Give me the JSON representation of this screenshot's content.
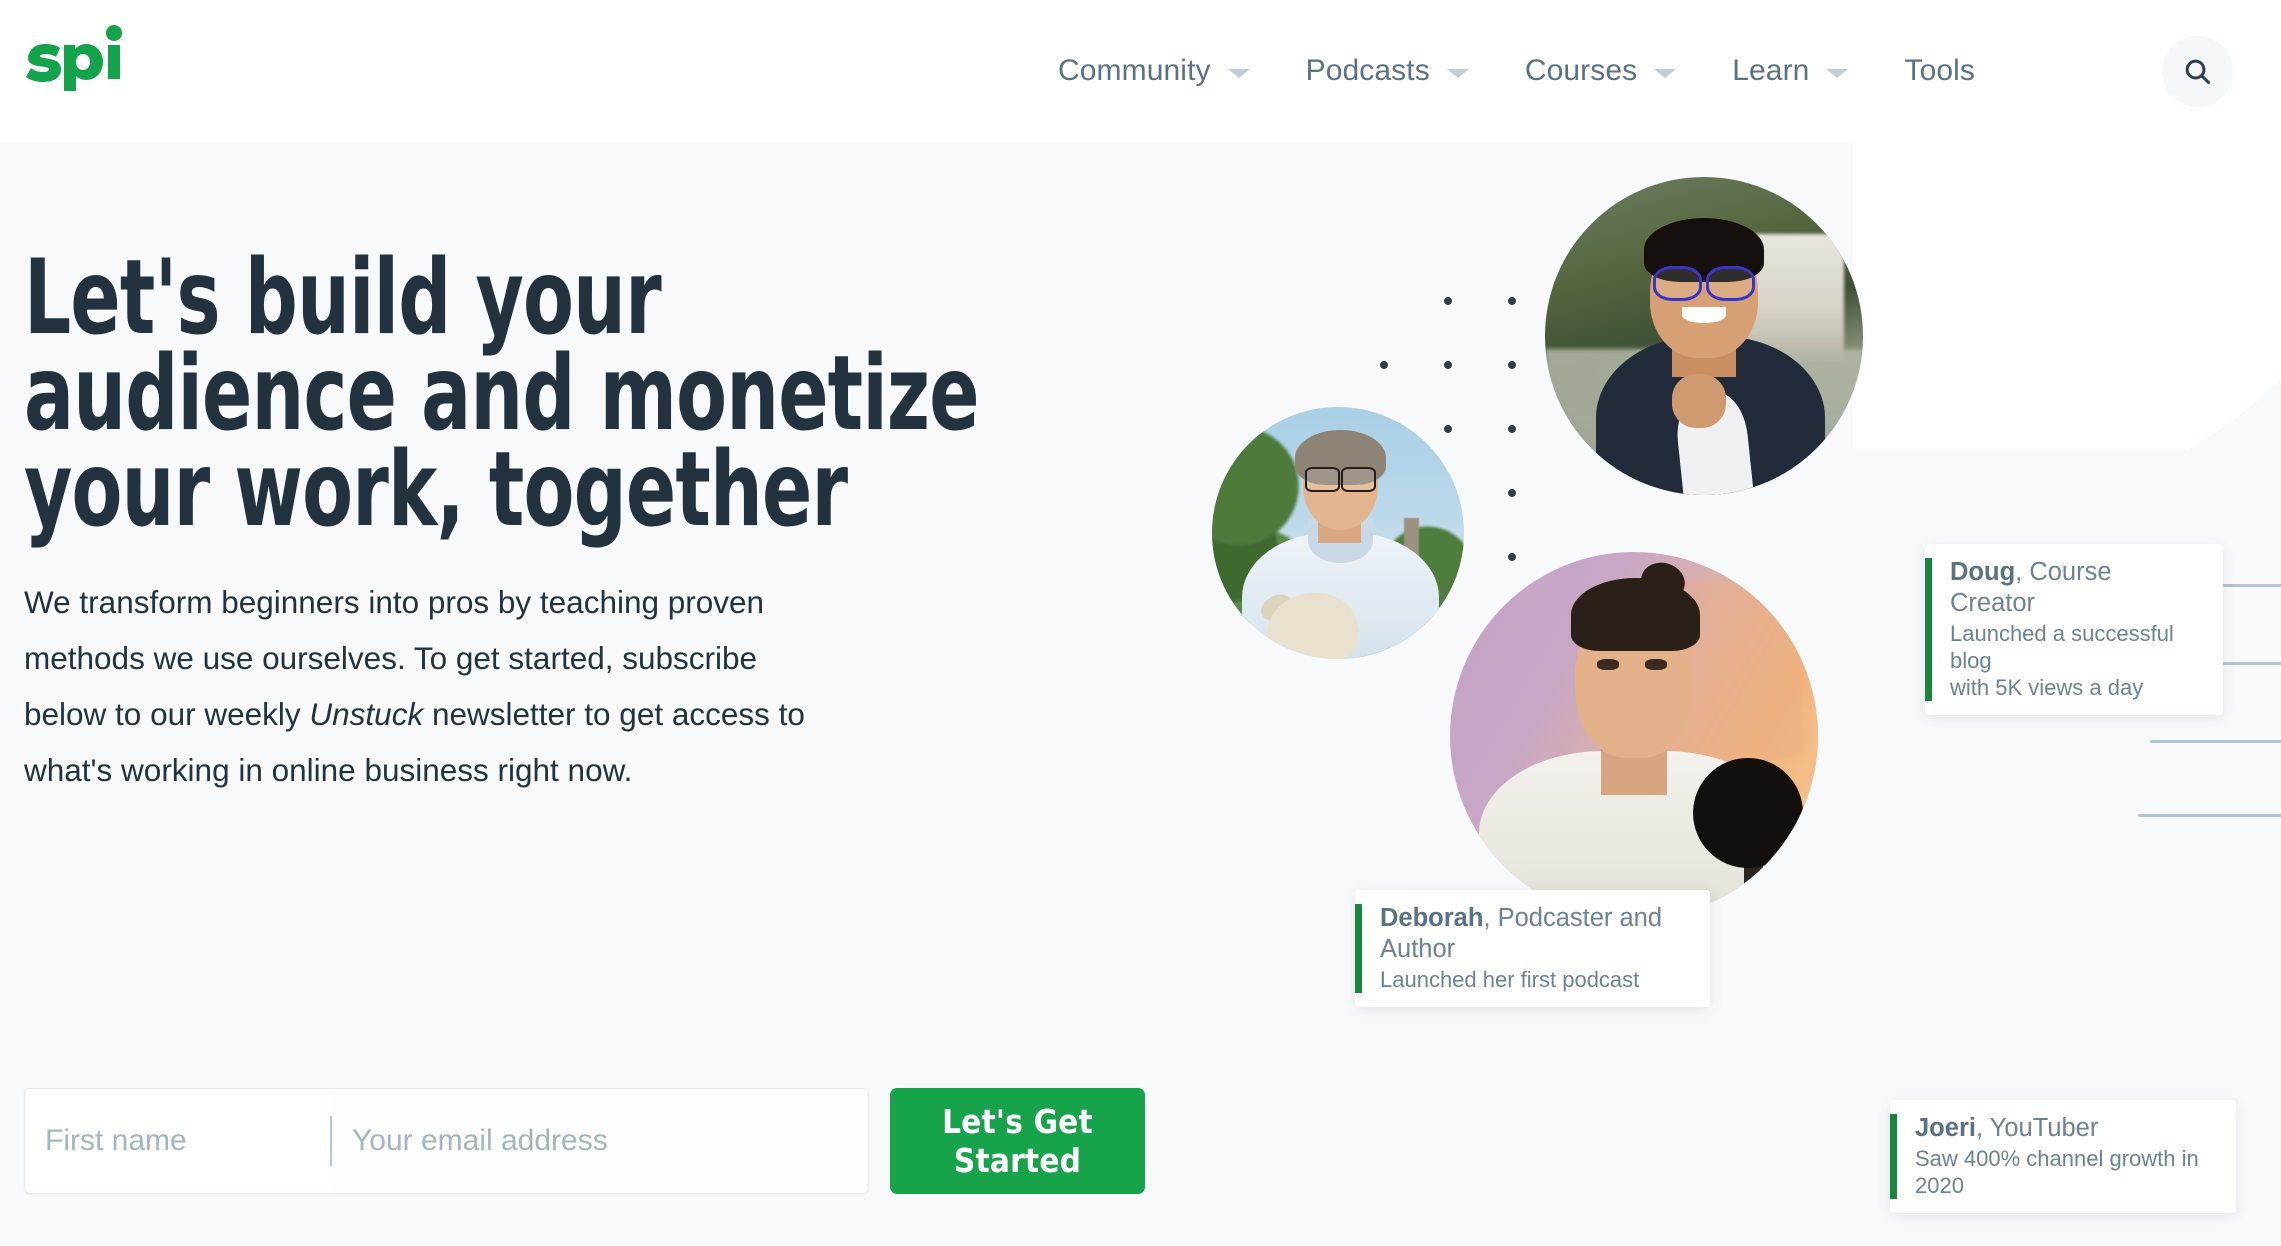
{
  "header": {
    "logo_text": "spi",
    "logo_color": "#13a34a",
    "nav_items": [
      {
        "label": "Community",
        "has_dropdown": true
      },
      {
        "label": "Podcasts",
        "has_dropdown": true
      },
      {
        "label": "Courses",
        "has_dropdown": true
      },
      {
        "label": "Learn",
        "has_dropdown": true
      },
      {
        "label": "Tools",
        "has_dropdown": false
      }
    ],
    "search_icon": "search-icon"
  },
  "hero": {
    "headline_line1": "Let's build your",
    "headline_line2": "audience and monetize",
    "headline_line3": "your work, together",
    "subcopy_part1": "We transform beginners into pros by teaching proven methods we use ourselves. To get started, subscribe below to our weekly ",
    "subcopy_italic": "Unstuck",
    "subcopy_part2": " newsletter to get access to what's working in online business right now.",
    "background_color": "#f8f9fb",
    "heading_color": "#22333f"
  },
  "form": {
    "first_name_placeholder": "First name",
    "first_name_value": "",
    "email_placeholder": "Your email address",
    "email_value": "",
    "cta_label": "Let's Get Started",
    "cta_color": "#17a34a"
  },
  "testimonials": [
    {
      "id": "doug",
      "name": "Doug",
      "role": ", Course Creator",
      "description": "Launched a successful blog\nwith 5K views a day",
      "accent_color": "#17863c"
    },
    {
      "id": "deborah",
      "name": "Deborah",
      "role": ", Podcaster and\nAuthor",
      "description": "Launched her first podcast",
      "accent_color": "#17863c"
    },
    {
      "id": "joeri",
      "name": "Joeri",
      "role": ", YouTuber",
      "description": "Saw 400% channel growth in 2020",
      "accent_color": "#17863c"
    }
  ],
  "decor": {
    "dot_color": "#2d3f4c",
    "line_color": "#b4c3d1"
  }
}
